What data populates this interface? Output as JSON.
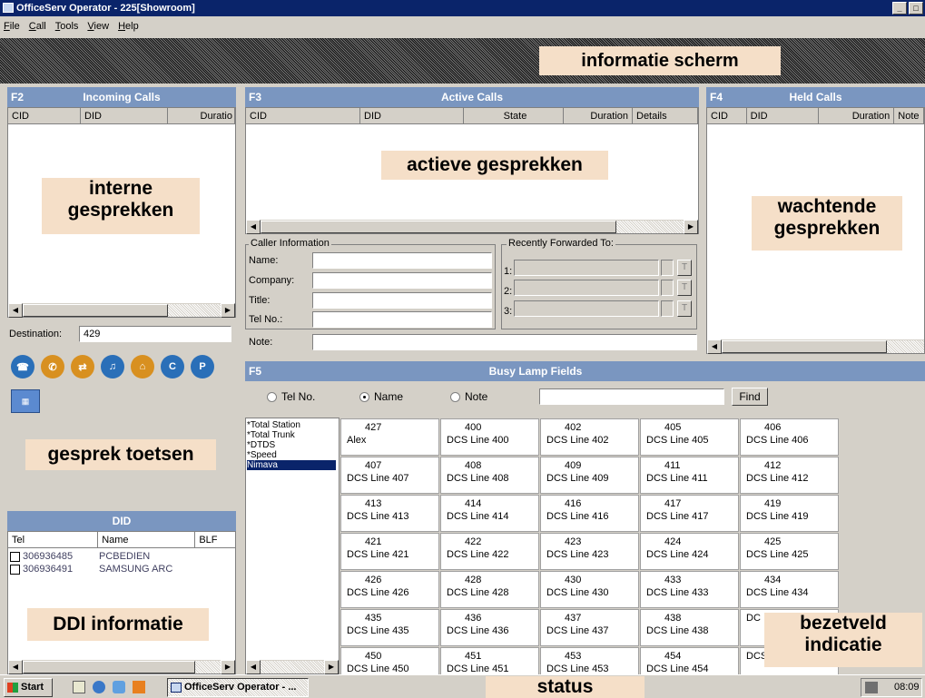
{
  "window": {
    "title": "OfficeServ Operator - 225[Showroom]",
    "controls": [
      "_",
      "□"
    ]
  },
  "menu": [
    {
      "accel": "F",
      "rest": "ile"
    },
    {
      "accel": "C",
      "rest": "all"
    },
    {
      "accel": "T",
      "rest": "ools"
    },
    {
      "accel": "V",
      "rest": "iew"
    },
    {
      "accel": "H",
      "rest": "elp"
    }
  ],
  "annotations": {
    "info": "informatie scherm",
    "interne1": "interne",
    "interne2": "gesprekken",
    "actieve": "actieve gesprekken",
    "wachtende1": "wachtende",
    "wachtende2": "gesprekken",
    "toetsen": "gesprek toetsen",
    "ddi": "DDI informatie",
    "bezet1": "bezetveld",
    "bezet2": "indicatie",
    "status": "status"
  },
  "incoming": {
    "key": "F2",
    "title": "Incoming Calls",
    "columns": [
      "CID",
      "DID",
      "Duratio"
    ]
  },
  "active": {
    "key": "F3",
    "title": "Active Calls",
    "columns": [
      "CID",
      "DID",
      "State",
      "Duration",
      "Details"
    ]
  },
  "held": {
    "key": "F4",
    "title": "Held Calls",
    "columns": [
      "CID",
      "DID",
      "Duration",
      "Note"
    ]
  },
  "caller": {
    "group": "Caller Information",
    "name": "Name:",
    "company": "Company:",
    "title": "Title:",
    "tel": "Tel No.:",
    "note": "Note:"
  },
  "forwarded": {
    "group": "Recently Forwarded To:",
    "rows": [
      "1:",
      "2:",
      "3:"
    ],
    "btn": "T"
  },
  "destination": {
    "label": "Destination:",
    "value": "429"
  },
  "call_buttons": [
    "phone-icon",
    "answer-icon",
    "transfer-icon",
    "hold-icon",
    "park-icon",
    "conference-icon",
    "page-icon",
    "keypad-icon"
  ],
  "did": {
    "title": "DID",
    "columns": [
      "Tel",
      "Name",
      "BLF"
    ],
    "rows": [
      {
        "tel": "306936485",
        "name": "PCBEDIEN"
      },
      {
        "tel": "306936491",
        "name": "SAMSUNG ARC"
      }
    ]
  },
  "blf": {
    "key": "F5",
    "title": "Busy Lamp Fields",
    "radio": [
      "Tel No.",
      "Name",
      "Note"
    ],
    "selected_radio": "Name",
    "find": "Find",
    "groups": [
      "*Total Station",
      "*Total Trunk",
      "*DTDS",
      "*Speed",
      "Nimava"
    ],
    "selected_group": "Nimava",
    "cells": [
      [
        "427",
        "Alex"
      ],
      [
        "400",
        "DCS Line 400"
      ],
      [
        "402",
        "DCS Line 402"
      ],
      [
        "405",
        "DCS Line 405"
      ],
      [
        "406",
        "DCS Line 406"
      ],
      [
        "407",
        "DCS Line 407"
      ],
      [
        "408",
        "DCS Line 408"
      ],
      [
        "409",
        "DCS Line 409"
      ],
      [
        "411",
        "DCS Line 411"
      ],
      [
        "412",
        "DCS Line 412"
      ],
      [
        "413",
        "DCS Line 413"
      ],
      [
        "414",
        "DCS Line 414"
      ],
      [
        "416",
        "DCS Line 416"
      ],
      [
        "417",
        "DCS Line 417"
      ],
      [
        "419",
        "DCS Line 419"
      ],
      [
        "421",
        "DCS Line 421"
      ],
      [
        "422",
        "DCS Line 422"
      ],
      [
        "423",
        "DCS Line 423"
      ],
      [
        "424",
        "DCS Line 424"
      ],
      [
        "425",
        "DCS Line 425"
      ],
      [
        "426",
        "DCS Line 426"
      ],
      [
        "428",
        "DCS Line 428"
      ],
      [
        "430",
        "DCS Line 430"
      ],
      [
        "433",
        "DCS Line 433"
      ],
      [
        "434",
        "DCS Line 434"
      ],
      [
        "435",
        "DCS Line 435"
      ],
      [
        "436",
        "DCS Line 436"
      ],
      [
        "437",
        "DCS Line 437"
      ],
      [
        "438",
        "DCS Line 438"
      ],
      [
        "",
        "DC"
      ],
      [
        "450",
        "DCS Line 450"
      ],
      [
        "451",
        "DCS Line 451"
      ],
      [
        "453",
        "DCS Line 453"
      ],
      [
        "454",
        "DCS Line 454"
      ],
      [
        "",
        "DCS Line 456"
      ]
    ]
  },
  "taskbar": {
    "start": "Start",
    "app": "OfficeServ Operator - ...",
    "clock": "08:09"
  }
}
